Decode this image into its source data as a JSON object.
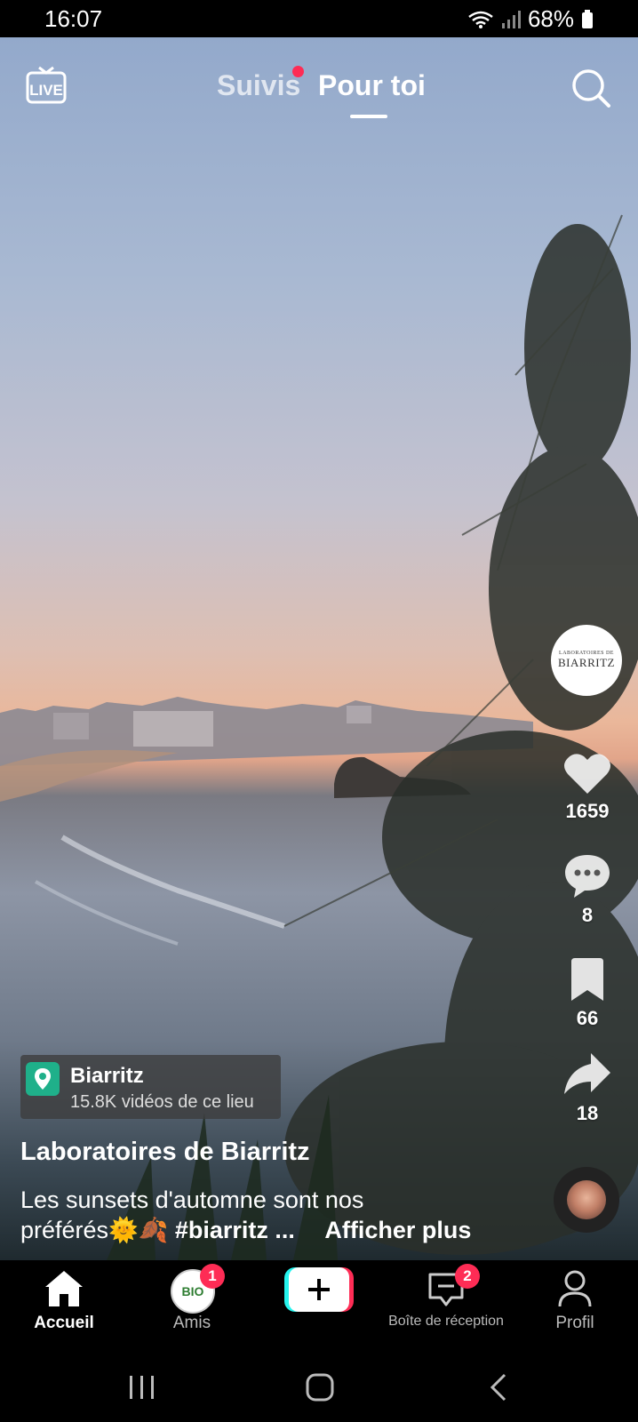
{
  "status_bar": {
    "time": "16:07",
    "battery": "68%"
  },
  "top_nav": {
    "live_label": "LIVE",
    "tabs": [
      {
        "label": "Suivis"
      },
      {
        "label": "Pour toi"
      }
    ],
    "active_tab": "Pour toi"
  },
  "creator": {
    "avatar_line1": "LABORATOIRES DE",
    "avatar_line2": "BIARRITZ"
  },
  "actions": {
    "likes": "1659",
    "comments": "8",
    "saves": "66",
    "shares": "18"
  },
  "location": {
    "name": "Biarritz",
    "subtitle": "15.8K vidéos de ce lieu"
  },
  "post": {
    "account": "Laboratoires de Biarritz",
    "caption_line1": "Les sunsets d'automne sont nos",
    "caption_line2": "préférés🌞🍂",
    "hashtag": "#biarritz ...",
    "more": "Afficher plus"
  },
  "bottom_nav": {
    "items": [
      {
        "label": "Accueil"
      },
      {
        "label": "Amis",
        "badge": "1",
        "avatar_text": "BIO"
      },
      {
        "label": ""
      },
      {
        "label": "Boîte de réception",
        "badge": "2"
      },
      {
        "label": "Profil"
      }
    ]
  },
  "colors": {
    "accent": "#fe2c55",
    "teal": "#25f4ee",
    "location_pin": "#1fb08a"
  }
}
